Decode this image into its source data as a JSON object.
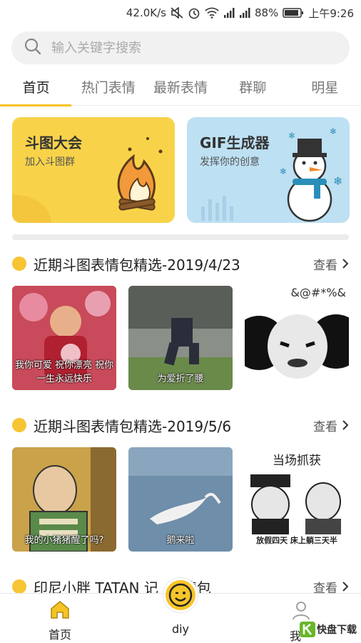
{
  "status_bar": {
    "speed": "42.0K/s",
    "battery": "88%",
    "time": "上午9:26"
  },
  "search": {
    "placeholder": "输入关键字搜索"
  },
  "tabs": [
    {
      "label": "首页",
      "active": true
    },
    {
      "label": "热门表情",
      "active": false
    },
    {
      "label": "最新表情",
      "active": false
    },
    {
      "label": "群聊",
      "active": false
    },
    {
      "label": "明星",
      "active": false
    }
  ],
  "banners": [
    {
      "title": "斗图大会",
      "subtitle": "加入斗图群",
      "color": "#f8d34a"
    },
    {
      "title": "GIF生成器",
      "subtitle": "发挥你的创意",
      "color": "#bde0f3"
    }
  ],
  "sections": [
    {
      "title": "近期斗图表情包精选-2019/4/23",
      "more": "查看",
      "thumbs": [
        {
          "caption": "我你可爱 祝你漂亮 祝你一生永远快乐"
        },
        {
          "caption": "为爱折了腰"
        },
        {
          "caption": "&@#*%&"
        }
      ]
    },
    {
      "title": "近期斗图表情包精选-2019/5/6",
      "more": "查看",
      "thumbs": [
        {
          "caption": "我的小猪猪醒了吗?"
        },
        {
          "caption": "鹅来啦"
        },
        {
          "caption_top": "当场抓获",
          "caption": "放假四天 床上躺三天半"
        }
      ]
    },
    {
      "title": "印尼小胖 TATAN 记",
      "title_tail": "情包",
      "more": "查看"
    }
  ],
  "bottom_nav": {
    "home": "首页",
    "diy": "diy",
    "me": "我"
  },
  "watermark": {
    "text": "快盘下载"
  },
  "colors": {
    "accent": "#f5c324",
    "text": "#222222"
  }
}
